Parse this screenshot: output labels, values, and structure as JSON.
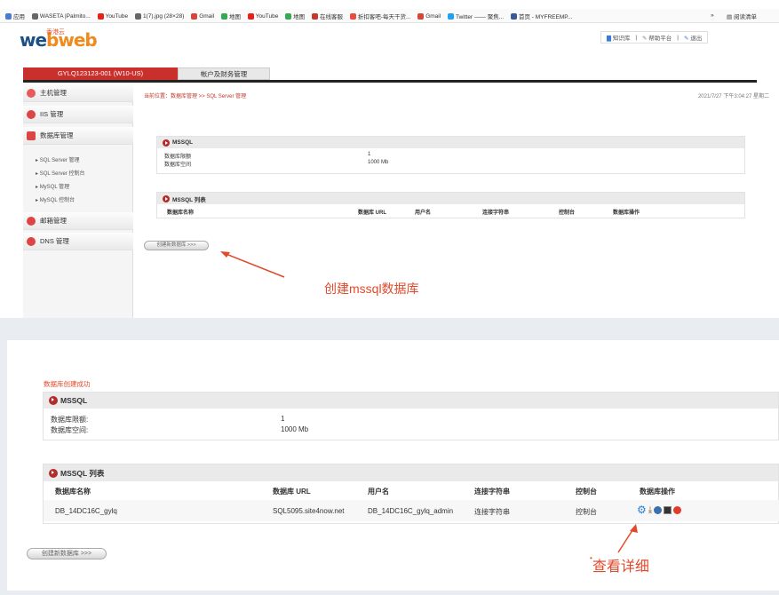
{
  "browser": {
    "bookmarks": [
      "应用",
      "WASETA |Palmito...",
      "YouTube",
      "1(7).jpg (28×28)",
      "Gmail",
      "地图",
      "YouTube",
      "地图",
      "在线客服",
      "折扣客吧-每天干货...",
      "Gmail",
      "Twitter —— 聚焦...",
      "首页 - MYFREEMP..."
    ],
    "overflow": "»",
    "reading_list": "阅读清单"
  },
  "logo": {
    "text_w": "we",
    "text_b": "bweb",
    "sub": "香港云"
  },
  "toplinks": [
    "知识库",
    "帮助平台",
    "退出"
  ],
  "tabs": {
    "active": "GYLQ123123-001 (W10-US)",
    "other": "帐户及财务管理"
  },
  "sidebar": {
    "items": [
      "主机管理",
      "IIS 管理",
      "数据库管理",
      "邮箱管理",
      "DNS 管理"
    ],
    "subitems": [
      "SQL Server 管理",
      "SQL Server 控制台",
      "MySQL 管理",
      "MySQL 控制台"
    ]
  },
  "top_content": {
    "breadcrumb": "当前位置：数据库管理 >> SQL Server 管理",
    "datetime": "2021/7/27 下午3:04:27 星期二",
    "mssql_title": "MSSQL",
    "quota_label": "数据库限额",
    "quota_value": "1",
    "space_label": "数据库空间",
    "space_value": "1000 Mb",
    "list_title": "MSSQL 列表",
    "columns": [
      "数据库名称",
      "数据库 URL",
      "用户名",
      "连接字符串",
      "控制台",
      "数据库操作"
    ],
    "create_button": "创建新数据库 >>>",
    "annotation": "创建mssql数据库"
  },
  "bottom_content": {
    "success": "数据库创建成功",
    "mssql_title": "MSSQL",
    "quota_label": "数据库限额:",
    "quota_value": "1",
    "space_label": "数据库空间:",
    "space_value": "1000 Mb",
    "list_title": "MSSQL 列表",
    "columns": [
      "数据库名称",
      "数据库 URL",
      "用户名",
      "连接字符串",
      "控制台",
      "数据库操作"
    ],
    "row": {
      "name": "DB_14DC16C_gylq",
      "url": "SQL5095.site4now.net",
      "user": "DB_14DC16C_gylq_admin",
      "conn": "连接字符串",
      "console": "控制台"
    },
    "create_button": "创建新数据库 >>>",
    "annotation": "查看详细"
  },
  "colors": {
    "accent": "#c9302c",
    "annotation": "#e04a2b",
    "brand_blue": "#1d4f87"
  }
}
